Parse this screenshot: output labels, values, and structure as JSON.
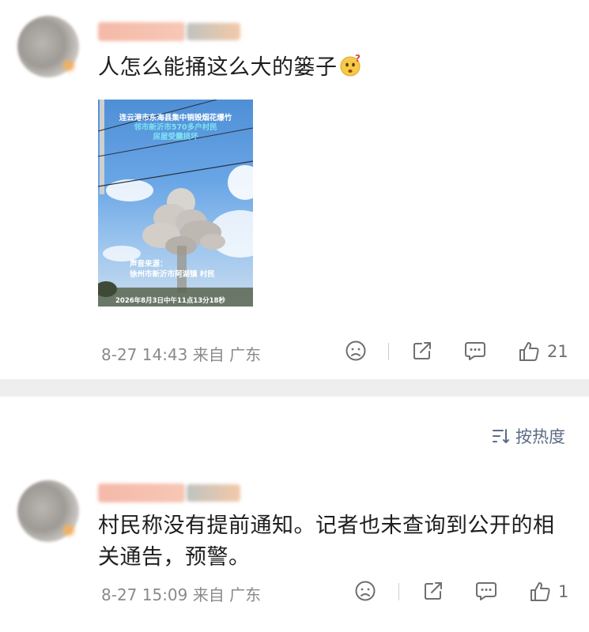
{
  "posts": [
    {
      "content": "人怎么能捅这么大的篓子",
      "media": {
        "caption1": "连云港市东海县集中销毁烟花爆竹",
        "caption2": "邻市新沂市570多户村民",
        "caption3": "房屋受震损坏",
        "source_label": "声音来源：",
        "source_value": "徐州市新沂市阿湖镇 村民",
        "timestamp": "2026年8月3日中午11点13分18秒"
      },
      "time": "8-27 14:43",
      "from": "来自 广东",
      "likes": "21"
    },
    {
      "content": "村民称没有提前通知。记者也未查询到公开的相关通告，预警。",
      "time": "8-27 15:09",
      "from": "来自 广东",
      "likes": "1"
    }
  ],
  "sort": {
    "label": "按热度"
  },
  "colors": {
    "accent": "#5b6b86",
    "meta": "#8a8a8a",
    "divider": "#eeeeee"
  },
  "icons": [
    "dislike-icon",
    "share-icon",
    "comment-icon",
    "like-icon",
    "sort-icon",
    "thinking-emoji-icon"
  ]
}
